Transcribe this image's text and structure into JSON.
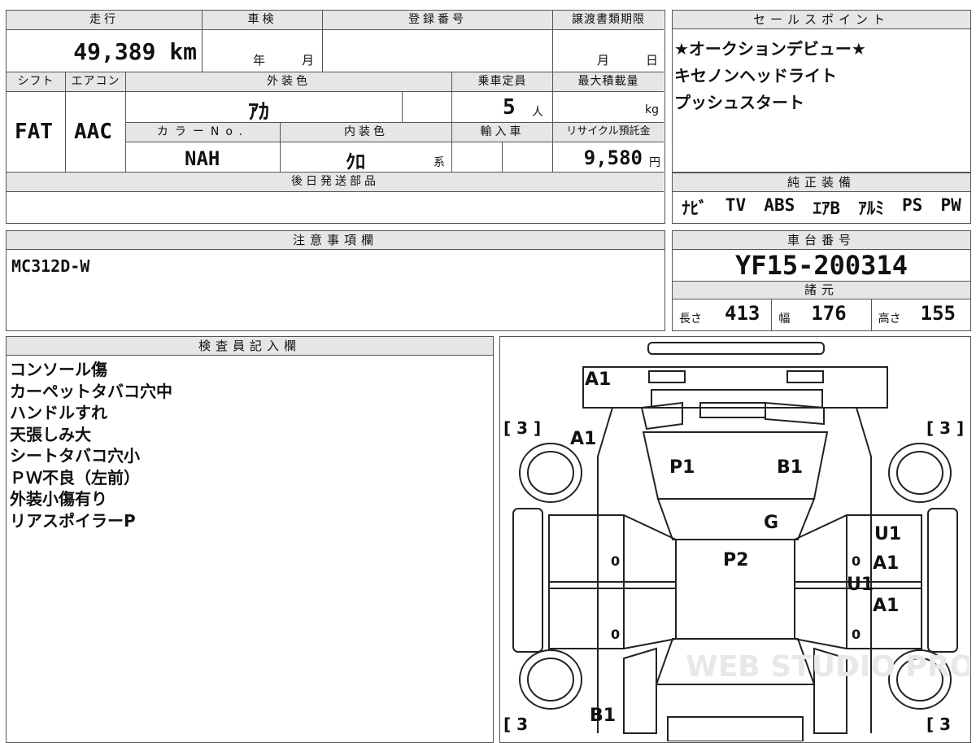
{
  "top_table": {
    "mileage_label": "走行",
    "mileage": "49,389 km",
    "inspection_label": "車検",
    "inspection_year_unit": "年",
    "inspection_month_unit": "月",
    "reg_label": "登録番号",
    "deadline_label": "譲渡書類期限",
    "deadline_month_unit": "月",
    "deadline_day_unit": "日",
    "shift_label": "シフト",
    "shift": "FAT",
    "ac_label": "エアコン",
    "ac": "AAC",
    "ext_color_label": "外装色",
    "ext_color": "ｱｶ",
    "capacity_label": "乗車定員",
    "capacity": "5",
    "capacity_unit": "人",
    "max_load_label": "最大積載量",
    "max_load_unit": "kg",
    "color_no_label": "カラーNo.",
    "color_no": "NAH",
    "int_color_label": "内装色",
    "int_color": "ｸﾛ",
    "int_color_unit": "系",
    "import_label": "輸入車",
    "recycle_label": "リサイクル預託金",
    "recycle": "9,580",
    "recycle_unit": "円",
    "later_parts_label": "後日発送部品"
  },
  "sales_points": {
    "label": "セールスポイント",
    "items": [
      "★オークションデビュー★",
      "キセノンヘッドライト",
      "プッシュスタート"
    ]
  },
  "genuine_equipment": {
    "label": "純正装備",
    "items": [
      "ﾅﾋﾞ",
      "TV",
      "ABS",
      "ｴｱB",
      "ｱﾙﾐ",
      "PS",
      "PW"
    ]
  },
  "notes": {
    "label": "注意事項欄",
    "text": "MC312D-W"
  },
  "chassis": {
    "label": "車台番号",
    "number": "YF15-200314",
    "specs_label": "諸元",
    "length_label": "長さ",
    "length": "413",
    "width_label": "幅",
    "width": "176",
    "height_label": "高さ",
    "height": "155"
  },
  "inspector": {
    "label": "検査員記入欄",
    "lines": [
      "コンソール傷",
      "カーペットタバコ穴中",
      "ハンドルすれ",
      "天張しみ大",
      "シートタバコ穴小",
      "ＰＷ不良（左前）",
      "外装小傷有り",
      "リアスポイラーP"
    ]
  },
  "diagram": {
    "marks": [
      "A1",
      "A1",
      "P1",
      "B1",
      "G",
      "P2",
      "U1",
      "A1",
      "U1",
      "A1",
      "B1"
    ],
    "tires": [
      "[ 3 ]",
      "[ 3 ]",
      "[ 3",
      "[ 3"
    ],
    "zeros": [
      "0",
      "0",
      "0",
      "0",
      "0"
    ],
    "watermark": "WEB STUDIO PRO"
  }
}
